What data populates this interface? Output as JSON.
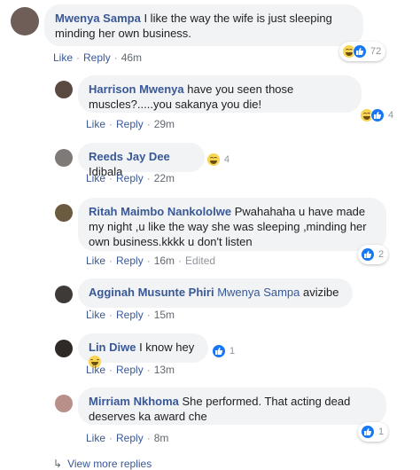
{
  "comments": [
    {
      "author": "Mwenya Sampa",
      "text": "I like the way the wife is just sleeping minding her own business.",
      "like": "Like",
      "reply": "Reply",
      "time": "46m",
      "reaction_count": "72",
      "reactions": [
        "haha-icon",
        "like-icon"
      ]
    }
  ],
  "replies": [
    {
      "author": "Harrison Mwenya",
      "text": "have you seen those muscles?.....you sakanya you die!",
      "like": "Like",
      "reply": "Reply",
      "time": "29m",
      "reaction_count": "4",
      "reactions": [
        "haha-icon",
        "like-icon"
      ]
    },
    {
      "author": "Reeds Jay Dee",
      "text": "Idibala",
      "like": "Like",
      "reply": "Reply",
      "time": "22m",
      "reaction_count": "4",
      "reactions": [
        "haha-icon"
      ]
    },
    {
      "author": "Ritah Maimbo Nankololwe",
      "text": "Pwahahaha u have made my night ,u like the way she was sleeping ,minding her own business.kkkk u don't listen",
      "like": "Like",
      "reply": "Reply",
      "time": "16m",
      "edited": "Edited",
      "reaction_count": "2",
      "reactions": [
        "like-icon"
      ]
    },
    {
      "author": "Agginah Musunte Phiri",
      "mention": "Mwenya Sampa",
      "text": "avizibe .",
      "like": "Like",
      "reply": "Reply",
      "time": "15m"
    },
    {
      "author": "Lin Diwe",
      "text": "I know hey",
      "like": "Like",
      "reply": "Reply",
      "time": "13m",
      "reaction_count": "1",
      "reactions": [
        "like-icon"
      ]
    },
    {
      "author": "Mirriam Nkhoma",
      "text": "She performed. That acting dead deserves ka award che",
      "like": "Like",
      "reply": "Reply",
      "time": "8m",
      "reaction_count": "1",
      "reactions": [
        "like-icon"
      ]
    }
  ],
  "view_more": "View more replies",
  "colors": {
    "link": "#385898",
    "bubble": "#f2f3f5",
    "like_blue": "#1877f2",
    "haha_yellow": "#f7d553"
  }
}
